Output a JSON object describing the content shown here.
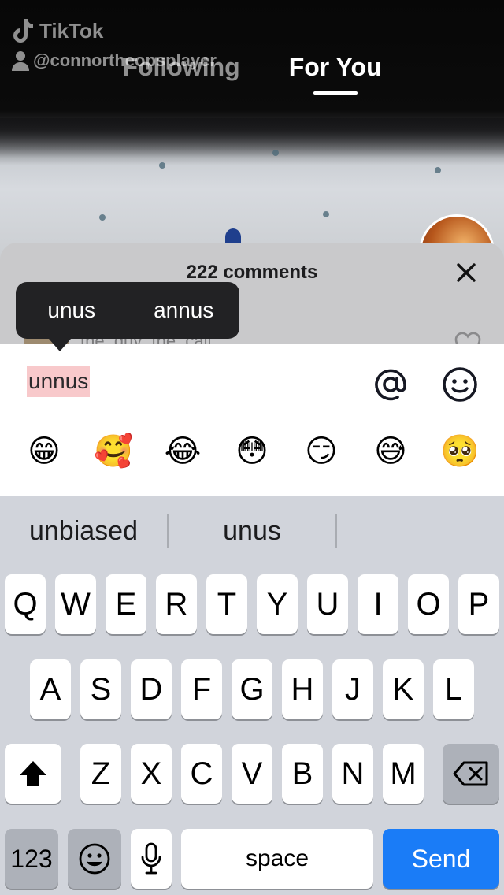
{
  "watermark": {
    "brand": "TikTok",
    "handle": "@connortheopsplayer"
  },
  "top_tabs": [
    {
      "label": "Following",
      "active": false
    },
    {
      "label": "For You",
      "active": true
    }
  ],
  "comments_panel": {
    "title": "222 comments",
    "peek_username": "the_guy_the_call"
  },
  "autocorrect_popover": {
    "options": [
      "unus",
      "annus"
    ]
  },
  "compose": {
    "input_value": "unnus",
    "highlight_color": "#f8c9cb",
    "emoji_row": [
      "😁",
      "🥰",
      "😂",
      "😳",
      "😏",
      "😅",
      "🥺"
    ]
  },
  "keyboard": {
    "suggestions": [
      "unbiased",
      "unus",
      ""
    ],
    "rows": [
      [
        "Q",
        "W",
        "E",
        "R",
        "T",
        "Y",
        "U",
        "I",
        "O",
        "P"
      ],
      [
        "A",
        "S",
        "D",
        "F",
        "G",
        "H",
        "J",
        "K",
        "L"
      ],
      [
        "Z",
        "X",
        "C",
        "V",
        "B",
        "N",
        "M"
      ]
    ],
    "shift_icon": "shift-arrow-icon",
    "backspace_icon": "backspace-icon",
    "numbers_label": "123",
    "emoji_icon": "emoji-keyboard-icon",
    "mic_icon": "microphone-icon",
    "space_label": "space",
    "send_label": "Send",
    "send_color": "#1a7cf7"
  }
}
